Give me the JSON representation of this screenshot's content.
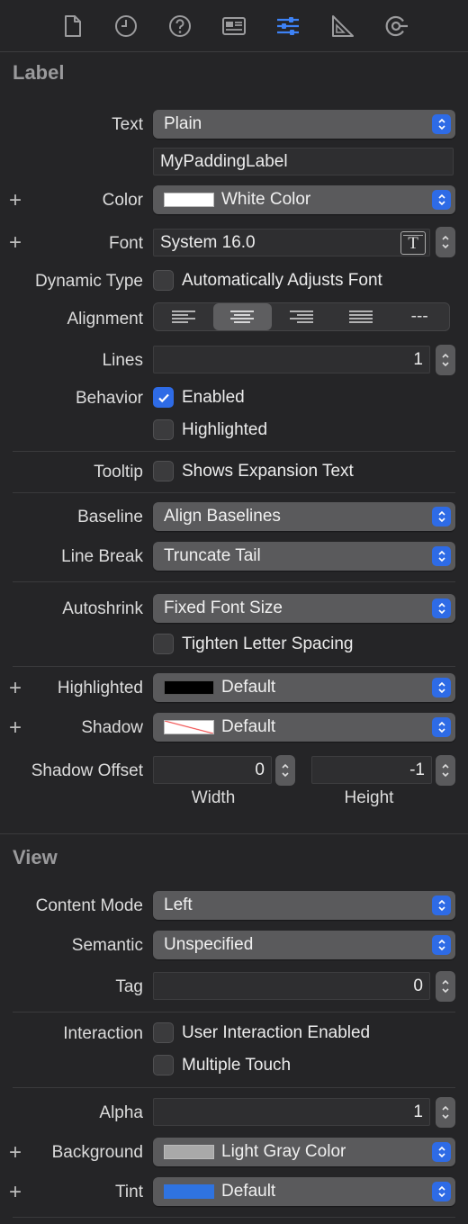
{
  "tabs": [
    "file-icon",
    "history-icon",
    "help-icon",
    "identity-icon",
    "attributes-icon",
    "size-icon",
    "connections-icon"
  ],
  "label_section": {
    "title": "Label",
    "text": {
      "label": "Text",
      "value": "Plain",
      "content": "MyPaddingLabel"
    },
    "color": {
      "label": "Color",
      "value": "White Color",
      "swatch": "#ffffff"
    },
    "font": {
      "label": "Font",
      "value": "System 16.0"
    },
    "dynamic_type": {
      "label": "Dynamic Type",
      "option": "Automatically Adjusts Font",
      "checked": false
    },
    "alignment": {
      "label": "Alignment",
      "options": [
        "left",
        "center",
        "right",
        "justified",
        "natural"
      ],
      "selected": "center",
      "natural_label": "---"
    },
    "lines": {
      "label": "Lines",
      "value": "1"
    },
    "behavior": {
      "label": "Behavior",
      "enabled": "Enabled",
      "enabled_checked": true,
      "highlighted": "Highlighted",
      "highlighted_checked": false
    },
    "tooltip": {
      "label": "Tooltip",
      "option": "Shows Expansion Text",
      "checked": false
    },
    "baseline": {
      "label": "Baseline",
      "value": "Align Baselines"
    },
    "line_break": {
      "label": "Line Break",
      "value": "Truncate Tail"
    },
    "autoshrink": {
      "label": "Autoshrink",
      "value": "Fixed Font Size",
      "tighten": "Tighten Letter Spacing",
      "tighten_checked": false
    },
    "highlighted": {
      "label": "Highlighted",
      "value": "Default",
      "swatch": "#000000"
    },
    "shadow": {
      "label": "Shadow",
      "value": "Default"
    },
    "shadow_offset": {
      "label": "Shadow Offset",
      "width": "0",
      "height": "-1",
      "width_label": "Width",
      "height_label": "Height"
    }
  },
  "view_section": {
    "title": "View",
    "content_mode": {
      "label": "Content Mode",
      "value": "Left"
    },
    "semantic": {
      "label": "Semantic",
      "value": "Unspecified"
    },
    "tag": {
      "label": "Tag",
      "value": "0"
    },
    "interaction": {
      "label": "Interaction",
      "user_interaction": "User Interaction Enabled",
      "user_interaction_checked": false,
      "multiple_touch": "Multiple Touch",
      "multiple_touch_checked": false
    },
    "alpha": {
      "label": "Alpha",
      "value": "1"
    },
    "background": {
      "label": "Background",
      "value": "Light Gray Color",
      "swatch": "#a9a9a9"
    },
    "tint": {
      "label": "Tint",
      "value": "Default",
      "swatch": "#2f73e0"
    }
  },
  "plus_symbol": "+",
  "accent": "#2e6be6"
}
